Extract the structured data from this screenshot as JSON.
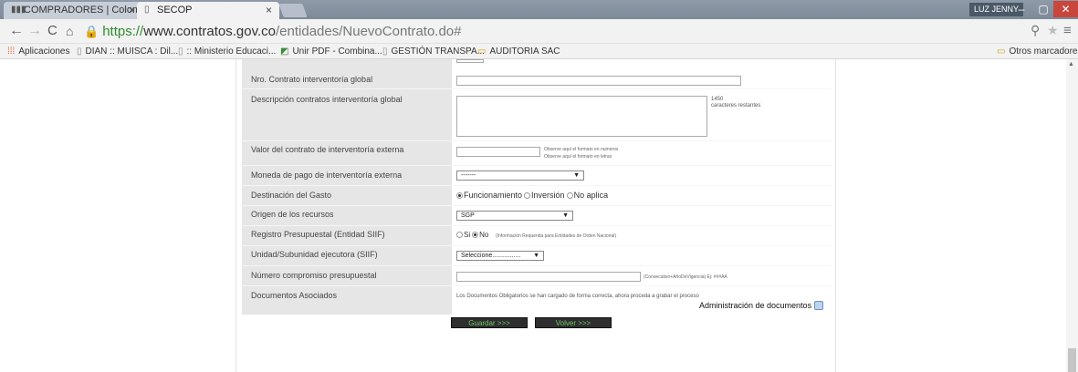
{
  "browser": {
    "tabs": [
      {
        "title": "COMPRADORES | Colomb"
      },
      {
        "title": "SECOP"
      }
    ],
    "tab_close": "×",
    "user": "LUZ JENNY",
    "window": {
      "minimize": "‒",
      "maximize": "▢",
      "close": "✕"
    },
    "url": {
      "https": "https://",
      "domain": "www.contratos.gov.co",
      "path": "/entidades/NuevoContrato.do#"
    },
    "bookmarks": [
      {
        "label": "Aplicaciones"
      },
      {
        "label": "DIAN :: MUISCA : Dil..."
      },
      {
        "label": ":: Ministerio Educaci..."
      },
      {
        "label": "Unir PDF - Combina..."
      },
      {
        "label": "GESTIÓN TRANSPA..."
      },
      {
        "label": "AUDITORIA SAC"
      },
      {
        "label": "Otros marcadores"
      }
    ]
  },
  "form": {
    "rows": {
      "contrato_interventoria": {
        "label": "Nro. Contrato interventoría global"
      },
      "descripcion_interventoria": {
        "label": "Descripción contratos interventoría global",
        "counter": "1450",
        "counter_text": "caracteres restantes"
      },
      "valor_interventoria": {
        "label": "Valor del contrato de interventoría externa",
        "hint_numbers": "Observe aquí el formato en numeros",
        "hint_letters": "Observe aquí el formato en letras"
      },
      "moneda_interventoria": {
        "label": "Moneda de pago de interventoría externa",
        "selected": "-------"
      },
      "destinacion_gasto": {
        "label": "Destinación del Gasto",
        "options": [
          "Funcionamiento",
          "Inversión",
          "No aplica"
        ]
      },
      "origen_recursos": {
        "label": "Origen de los recursos",
        "selected": "SGP"
      },
      "registro_presupuestal": {
        "label": "Registro Presupuestal (Entidad SIIF)",
        "options": [
          "Si",
          "No"
        ],
        "note": "(Información Requerida para Entidades de Orden Nacional)"
      },
      "unidad_ejecutora": {
        "label": "Unidad/Subunidad ejecutora (SIIF)",
        "selected": "Seleccione................"
      },
      "numero_compromiso": {
        "label": "Número compromiso presupuestal",
        "hint": "(Consecutivo+AñoDeVigencia) Ej: ###AA"
      },
      "documentos_asociados": {
        "label": "Documentos Asociados",
        "message": "Los Documentos Obligatorios se han cargado de forma correcta, ahora proceda a grabar el proceso",
        "admin_link": "Administración de documentos"
      }
    },
    "buttons": {
      "save": "Guardar >>>",
      "back": "Volver >>>"
    }
  }
}
